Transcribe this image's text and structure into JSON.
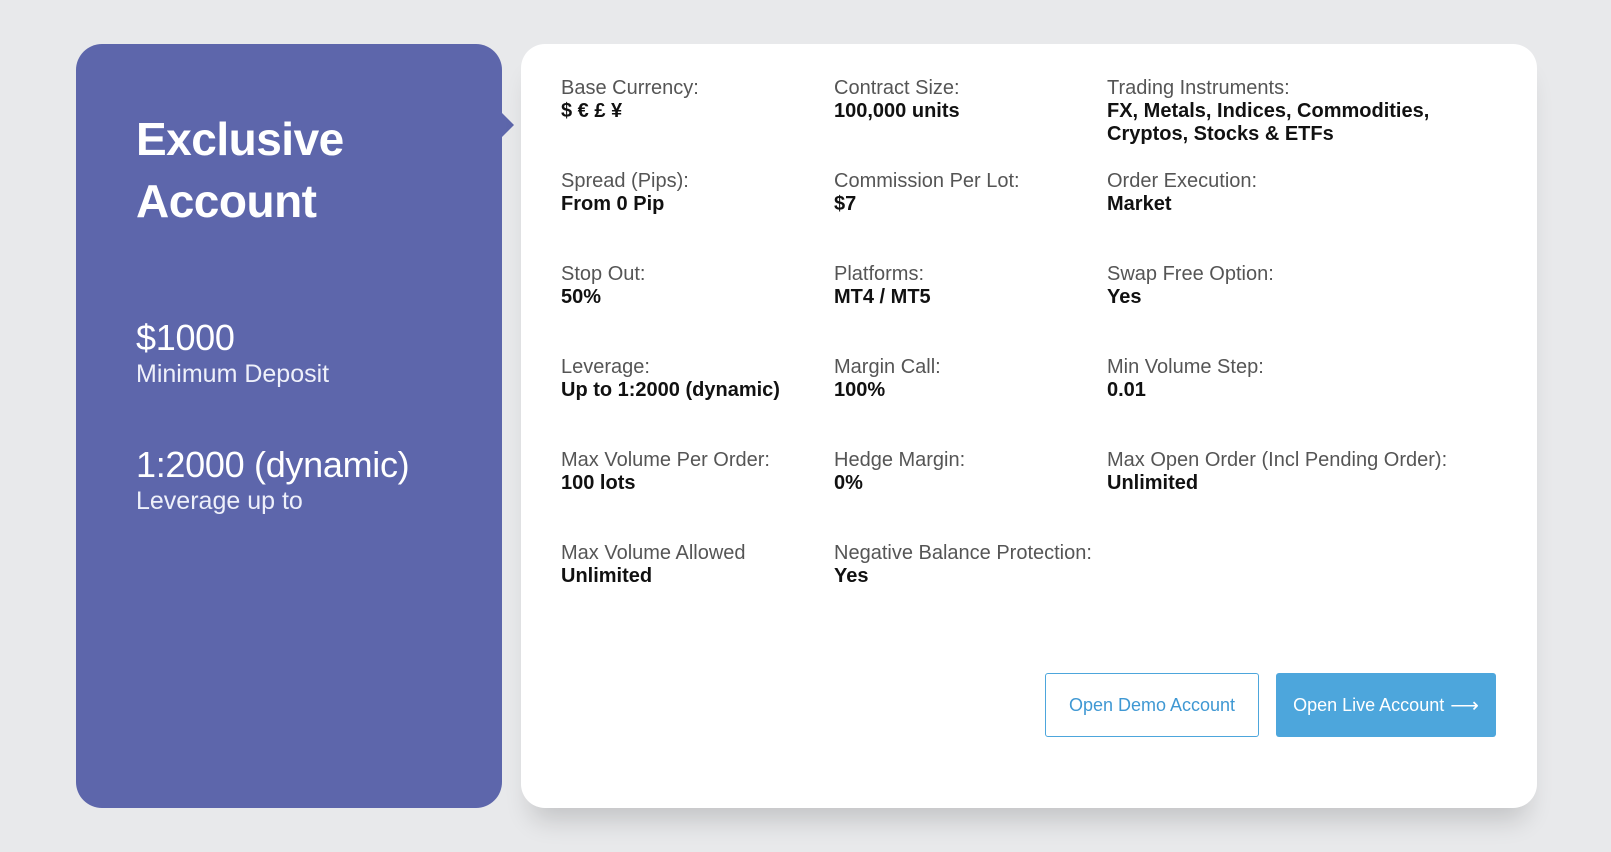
{
  "account": {
    "title": "Exclusive Account",
    "deposit_value": "$1000",
    "deposit_label": "Minimum Deposit",
    "leverage_value": "1:2000 (dynamic)",
    "leverage_label": "Leverage up to"
  },
  "specs": [
    [
      {
        "label": "Base Currency:",
        "value": "$ € £ ¥"
      },
      {
        "label": "Contract Size:",
        "value": "100,000 units"
      },
      {
        "label": "Trading Instruments:",
        "value": "FX, Metals, Indices, Commodities, Cryptos, Stocks & ETFs"
      }
    ],
    [
      {
        "label": "Spread (Pips):",
        "value": "From 0 Pip"
      },
      {
        "label": "Commission Per Lot:",
        "value": "$7"
      },
      {
        "label": "Order Execution:",
        "value": "Market"
      }
    ],
    [
      {
        "label": "Stop Out:",
        "value": "50%"
      },
      {
        "label": "Platforms:",
        "value": "MT4 / MT5"
      },
      {
        "label": "Swap Free Option:",
        "value": "Yes"
      }
    ],
    [
      {
        "label": "Leverage:",
        "value": "Up to 1:2000 (dynamic)"
      },
      {
        "label": "Margin Call:",
        "value": "100%"
      },
      {
        "label": "Min Volume Step:",
        "value": "0.01"
      }
    ],
    [
      {
        "label": "Max Volume Per Order:",
        "value": "100 lots"
      },
      {
        "label": "Hedge Margin:",
        "value": "0%"
      },
      {
        "label": "Max Open Order (Incl Pending Order):",
        "value": "Unlimited"
      }
    ],
    [
      {
        "label": "Max Volume Allowed",
        "value": "Unlimited"
      },
      {
        "label": "Negative Balance Protection:",
        "value": "Yes"
      }
    ]
  ],
  "buttons": {
    "demo_label": "Open Demo Account",
    "live_label": "Open Live Account",
    "live_icon": "arrow-right-icon"
  },
  "colors": {
    "card_accent": "#5d66ab",
    "button_blue": "#4da6dc",
    "page_bg": "#e8e9eb"
  }
}
